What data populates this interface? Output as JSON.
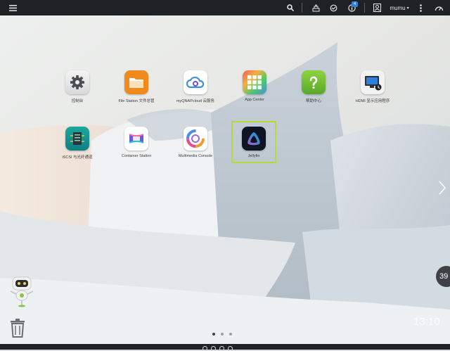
{
  "topbar": {
    "notification_count": "4",
    "username": "mumu",
    "username_caret": "▾"
  },
  "apps": [
    {
      "label": "控制台",
      "icon": "gear-icon"
    },
    {
      "label": "File Station 文件总管",
      "icon": "folder-icon"
    },
    {
      "label": "myQNAPcloud 云服务",
      "icon": "cloud-icon"
    },
    {
      "label": "App Center",
      "icon": "app-grid-icon"
    },
    {
      "label": "帮助中心",
      "icon": "help-icon"
    },
    {
      "label": "HDMI 显示应用程序",
      "icon": "hdmi-display-icon"
    },
    {
      "label": "iSCSI 与光纤通道",
      "icon": "iscsi-icon"
    },
    {
      "label": "Container Station",
      "icon": "container-icon"
    },
    {
      "label": "Multimedia Console",
      "icon": "multimedia-icon"
    },
    {
      "label": "Jellyfin",
      "icon": "jellyfin-icon"
    }
  ],
  "pagination": {
    "pages": 3,
    "current": 1
  },
  "clock": "13:10",
  "side_bubble": "39"
}
